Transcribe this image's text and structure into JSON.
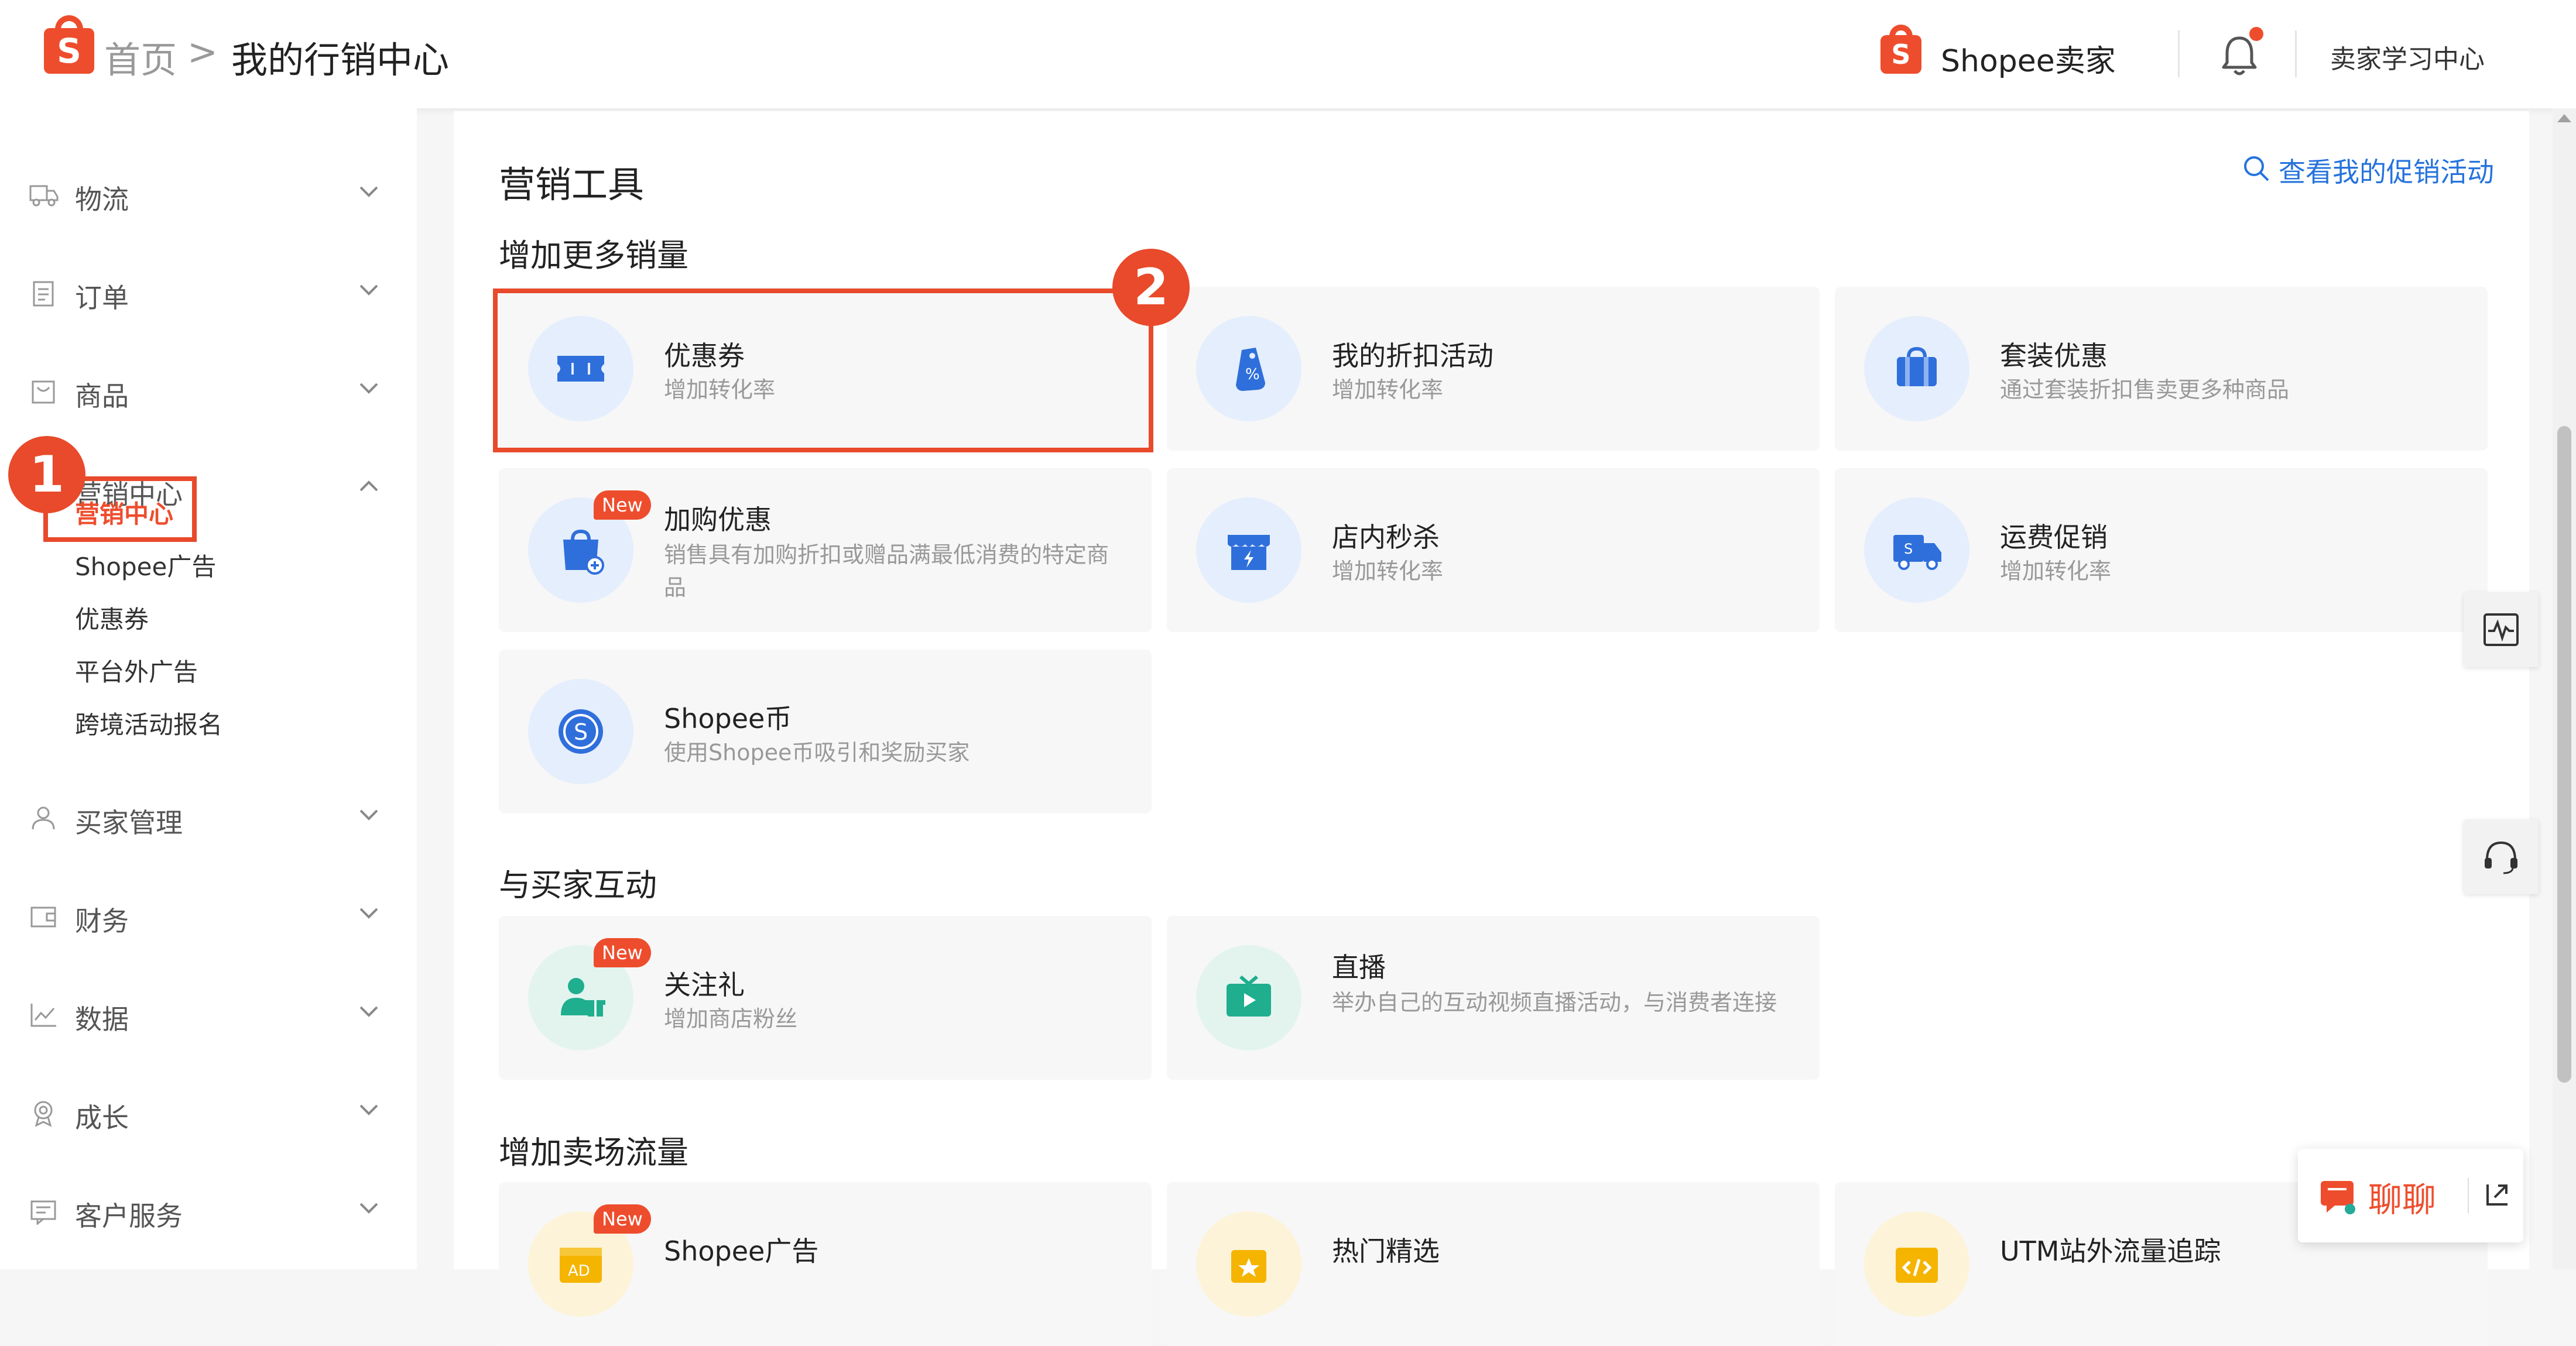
{
  "header": {
    "logo_letter": "S",
    "home": "首页",
    "separator": ">",
    "current": "我的行销中心",
    "brand": "Shopee卖家",
    "learning_center": "卖家学习中心"
  },
  "sidebar": {
    "items": [
      {
        "label": "物流"
      },
      {
        "label": "订单"
      },
      {
        "label": "商品"
      },
      {
        "label": "营销中心"
      },
      {
        "label": "买家管理"
      },
      {
        "label": "财务"
      },
      {
        "label": "数据"
      },
      {
        "label": "成长"
      },
      {
        "label": "客户服务"
      }
    ],
    "marketing_sub": [
      "营销中心",
      "Shopee广告",
      "优惠券",
      "平台外广告",
      "跨境活动报名"
    ]
  },
  "annotations": {
    "step1": "1",
    "step2": "2"
  },
  "main": {
    "title": "营销工具",
    "view_promotions": "查看我的促销活动",
    "sections": [
      {
        "title": "增加更多销量",
        "cards": [
          {
            "title": "优惠券",
            "desc": "增加转化率",
            "icon": "coupon-icon"
          },
          {
            "title": "我的折扣活动",
            "desc": "增加转化率",
            "icon": "discount-tag-icon"
          },
          {
            "title": "套装优惠",
            "desc": "通过套装折扣售卖更多种商品",
            "icon": "bundle-bag-icon"
          },
          {
            "title": "加购优惠",
            "desc": "销售具有加购折扣或赠品满最低消费的特定商品",
            "icon": "add-on-bag-icon",
            "badge": "New"
          },
          {
            "title": "店内秒杀",
            "desc": "增加转化率",
            "icon": "flash-sale-shop-icon"
          },
          {
            "title": "运费促销",
            "desc": "增加转化率",
            "icon": "shipping-truck-icon"
          },
          {
            "title": "Shopee币",
            "desc": "使用Shopee币吸引和奖励买家",
            "icon": "shopee-coin-icon"
          }
        ]
      },
      {
        "title": "与买家互动",
        "cards": [
          {
            "title": "关注礼",
            "desc": "增加商店粉丝",
            "icon": "follow-gift-icon",
            "badge": "New"
          },
          {
            "title": "直播",
            "desc": "举办自己的互动视频直播活动，与消费者连接",
            "icon": "live-stream-icon"
          }
        ]
      },
      {
        "title": "增加卖场流量",
        "cards": [
          {
            "title": "Shopee广告",
            "desc": "",
            "icon": "ad-icon",
            "badge": "New",
            "icon_text": "AD"
          },
          {
            "title": "热门精选",
            "desc": "",
            "icon": "top-picks-icon"
          },
          {
            "title": "UTM站外流量追踪",
            "desc": "",
            "icon": "utm-code-icon"
          }
        ]
      }
    ]
  },
  "chat": {
    "label": "聊聊"
  },
  "colors": {
    "brand": "#ee4d2d",
    "link": "#2673dd",
    "icon_blue": "#2f6fdb",
    "icon_teal": "#1fae8e",
    "icon_amber": "#f5b400"
  }
}
